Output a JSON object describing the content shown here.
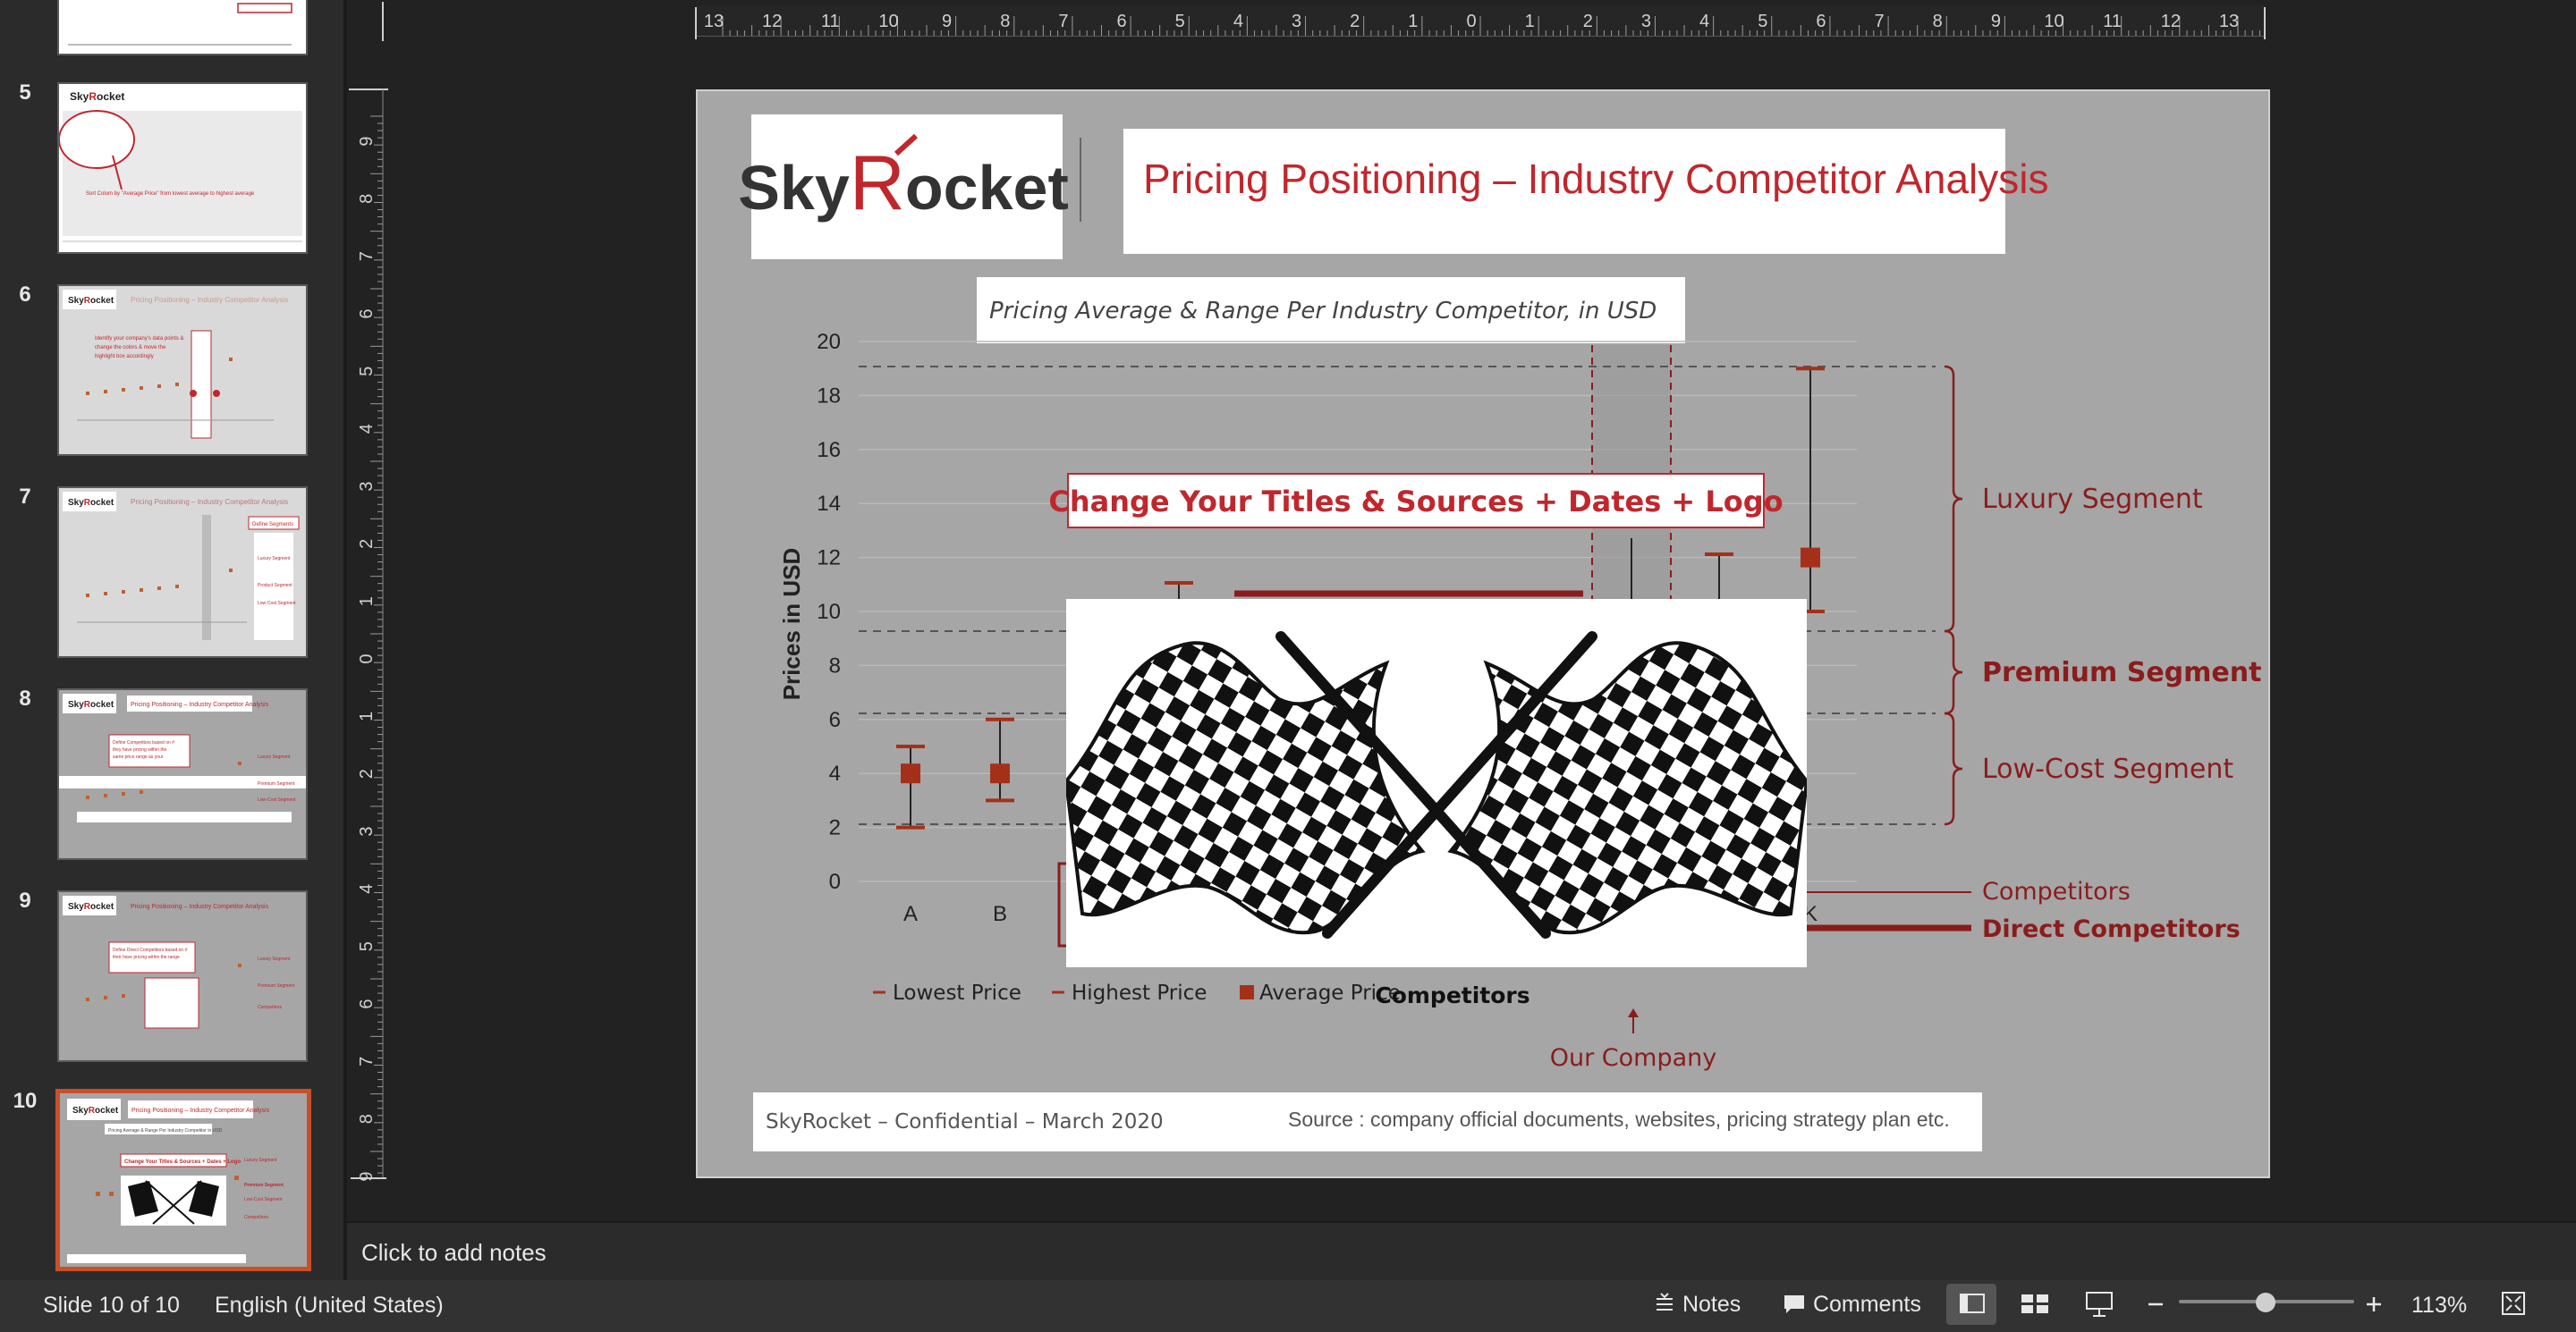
{
  "thumbnails": [
    {
      "num": "5",
      "caption": "Sort Colum by \"Average Price\" from lowest average to highest average"
    },
    {
      "num": "6",
      "caption": "Identify your company's data points & change the colors & move the highlight box accordingly"
    },
    {
      "num": "7",
      "caption": "Define Segments"
    },
    {
      "num": "8",
      "caption": "Define Competitors based on # they have pricing within the same price range as your main Segment"
    },
    {
      "num": "9",
      "caption": "Define Direct Competitors based on # their have pricing within the range of your main segment"
    },
    {
      "num": "10",
      "caption": "Change Your Titles & Sources + Dates + Logo"
    }
  ],
  "ruler": {
    "h_labels": [
      "13",
      "12",
      "11",
      "10",
      "9",
      "8",
      "7",
      "6",
      "5",
      "4",
      "3",
      "2",
      "1",
      "0",
      "1",
      "2",
      "3",
      "4",
      "5",
      "6",
      "7",
      "8",
      "9",
      "10",
      "11",
      "12",
      "13"
    ],
    "v_labels": [
      "9",
      "8",
      "7",
      "6",
      "5",
      "4",
      "3",
      "2",
      "1",
      "0",
      "1",
      "2",
      "3",
      "4",
      "5",
      "6",
      "7",
      "8",
      "9"
    ]
  },
  "slide": {
    "logo_text": "SkyRocket",
    "title": "Pricing Positioning – Industry Competitor Analysis",
    "chart_title": "Pricing Average & Range Per Industry Competitor, in USD",
    "callout": "Change Your Titles & Sources + Dates  + Logo",
    "segments": {
      "luxury": "Luxury Segment",
      "premium": "Premium Segment",
      "low_cost": "Low-Cost Segment",
      "competitors": "Competitors",
      "direct_competitors": "Direct Competitors"
    },
    "our_company": "Our Company",
    "footer_left": "SkyRocket – Confidential – March 2020",
    "footer_right": "Source : company official documents, websites, pricing strategy plan etc.",
    "image_alt": "checkered-flags-image"
  },
  "chart_data": {
    "type": "scatter",
    "title": "Pricing Average & Range Per Industry Competitor, in USD",
    "xlabel": "Competitors",
    "ylabel": "Prices in USD",
    "ylim": [
      0,
      20
    ],
    "yticks": [
      0,
      2,
      4,
      6,
      8,
      10,
      12,
      14,
      16,
      18,
      20
    ],
    "categories": [
      "A",
      "B",
      "K"
    ],
    "series": [
      {
        "name": "Lowest Price",
        "values": [
          2,
          3,
          10
        ]
      },
      {
        "name": "Highest Price",
        "values": [
          5,
          6,
          19
        ]
      },
      {
        "name": "Average Price",
        "values": [
          4,
          4,
          12
        ]
      }
    ],
    "partial_visible": [
      {
        "highest": 11
      },
      {
        "highest": 12
      }
    ],
    "legend": [
      "Lowest Price",
      "Highest Price",
      "Average Price"
    ],
    "grid": true,
    "legend_position": "bottom-left",
    "colors": {
      "series": "#a5301a",
      "segment": "#8a1c1c"
    }
  },
  "status": {
    "slide_info": "Slide 10 of 10",
    "language": "English (United States)",
    "notes_label": "Notes",
    "comments_label": "Comments",
    "zoom_level": "113%"
  },
  "notes": {
    "placeholder": "Click to add notes"
  },
  "colors": {
    "accent": "#c8502b",
    "brand_red": "#c0272d",
    "segment_red": "#8a1c1c"
  }
}
